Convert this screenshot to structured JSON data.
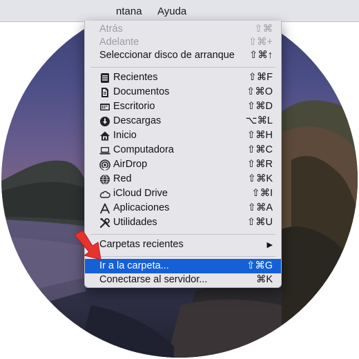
{
  "menubar": {
    "window_menu": "ntana",
    "help_menu": "Ayuda"
  },
  "menu": {
    "history": [
      {
        "label": "Atrás",
        "shortcut": "⇧⌘",
        "disabled": true
      },
      {
        "label": "Adelante",
        "shortcut": "⇧⌘+",
        "disabled": true
      },
      {
        "label": "Seleccionar disco de arranque",
        "shortcut": "⇧⌘↑",
        "disabled": false
      }
    ],
    "places": [
      {
        "label": "Recientes",
        "shortcut": "⇧⌘F",
        "icon": "recents-icon"
      },
      {
        "label": "Documentos",
        "shortcut": "⇧⌘O",
        "icon": "documents-icon"
      },
      {
        "label": "Escritorio",
        "shortcut": "⇧⌘D",
        "icon": "desktop-icon"
      },
      {
        "label": "Descargas",
        "shortcut": "⌥⌘L",
        "icon": "downloads-icon"
      },
      {
        "label": "Inicio",
        "shortcut": "⇧⌘H",
        "icon": "home-icon"
      },
      {
        "label": "Computadora",
        "shortcut": "⇧⌘C",
        "icon": "computer-icon"
      },
      {
        "label": "AirDrop",
        "shortcut": "⇧⌘R",
        "icon": "airdrop-icon"
      },
      {
        "label": "Red",
        "shortcut": "⇧⌘K",
        "icon": "network-icon"
      },
      {
        "label": "iCloud Drive",
        "shortcut": "⇧⌘I",
        "icon": "icloud-icon"
      },
      {
        "label": "Aplicaciones",
        "shortcut": "⇧⌘A",
        "icon": "applications-icon"
      },
      {
        "label": "Utilidades",
        "shortcut": "⇧⌘U",
        "icon": "utilities-icon"
      }
    ],
    "recent_folders": {
      "label": "Carpetas recientes",
      "submenu_indicator": "▶"
    },
    "go_to_folder": {
      "label": "Ir a la carpeta...",
      "shortcut": "⇧⌘G",
      "selected": true
    },
    "connect_server": {
      "label": "Conectarse al servidor...",
      "shortcut": "⌘K"
    }
  },
  "colors": {
    "selection": "#1560d6",
    "arrow": "#e8322d"
  }
}
